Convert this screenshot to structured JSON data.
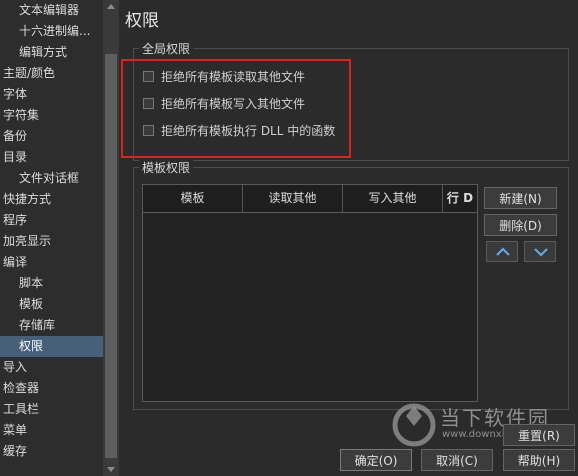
{
  "tree": {
    "items": [
      {
        "label": "文本编辑器",
        "level": 1
      },
      {
        "label": "十六进制编...",
        "level": 1
      },
      {
        "label": "编辑方式",
        "level": 1
      },
      {
        "label": "主题/颜色",
        "level": 0
      },
      {
        "label": "字体",
        "level": 0
      },
      {
        "label": "字符集",
        "level": 0
      },
      {
        "label": "备份",
        "level": 0
      },
      {
        "label": "目录",
        "level": 0
      },
      {
        "label": "文件对话框",
        "level": 1
      },
      {
        "label": "快捷方式",
        "level": 0
      },
      {
        "label": "程序",
        "level": 0
      },
      {
        "label": "加亮显示",
        "level": 0
      },
      {
        "label": "编译",
        "level": 0
      },
      {
        "label": "脚本",
        "level": 1
      },
      {
        "label": "模板",
        "level": 1
      },
      {
        "label": "存储库",
        "level": 1
      },
      {
        "label": "权限",
        "level": 1,
        "selected": true
      },
      {
        "label": "导入",
        "level": 0
      },
      {
        "label": "检查器",
        "level": 0
      },
      {
        "label": "工具栏",
        "level": 0
      },
      {
        "label": "菜单",
        "level": 0
      },
      {
        "label": "缓存",
        "level": 0
      }
    ]
  },
  "page": {
    "title": "权限"
  },
  "global_perms": {
    "title": "全局权限",
    "options": [
      {
        "label": "拒绝所有模板读取其他文件",
        "checked": false
      },
      {
        "label": "拒绝所有模板写入其他文件",
        "checked": false
      },
      {
        "label": "拒绝所有模板执行 DLL 中的函数",
        "checked": false
      }
    ]
  },
  "template_perms": {
    "title": "模板权限",
    "columns": [
      "模板",
      "读取其他",
      "写入其他",
      "行 D"
    ],
    "new_label": "新建(N)",
    "delete_label": "删除(D)"
  },
  "buttons": {
    "reset": "重置(R)",
    "ok": "确定(O)",
    "cancel": "取消(C)",
    "help": "帮助(H)"
  },
  "watermark": {
    "name": "当下软件园",
    "url": "www.downxia.com"
  },
  "colors": {
    "highlight": "#e0201e",
    "selection": "#47607a",
    "arrow": "#5ea8e8"
  }
}
